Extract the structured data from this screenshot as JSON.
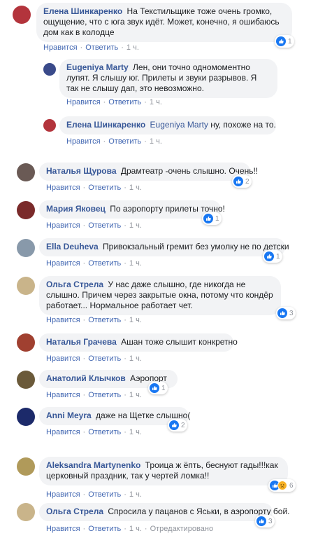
{
  "comments": [
    {
      "author": "Елена Шинкаренко",
      "text": "На Текстильщике тоже очень громко, ощущение, что с юга звук идёт. Может, конечно, я ошибаюсь дом как в колодце",
      "like": "Нравится",
      "reply": "Ответить",
      "time": "1 ч.",
      "reactions": "1",
      "avatar_color": "#b3343c"
    },
    {
      "author": "Eugeniya Marty",
      "text": "Лен, они точно одномоментно лупят. Я слышу юг. Прилеты и звуки разрывов. Я так не слышу дап, это невозможно.",
      "like": "Нравится",
      "reply": "Ответить",
      "time": "1 ч.",
      "avatar_color": "#3a4a8a"
    },
    {
      "author": "Елена Шинкаренко",
      "reply_to": "Eugeniya Marty",
      "text": "ну, похоже на то...",
      "like": "Нравится",
      "reply": "Ответить",
      "time": "1 ч.",
      "avatar_color": "#b3343c"
    },
    {
      "author": "Наталья Щурова",
      "text": "Драмтеатр -очень слышно. Очень!!",
      "like": "Нравится",
      "reply": "Ответить",
      "time": "1 ч.",
      "reactions": "2",
      "avatar_color": "#6a5a55"
    },
    {
      "author": "Мария Яковец",
      "text": "По аэропорту прилеты точно!",
      "like": "Нравится",
      "reply": "Ответить",
      "time": "1 ч.",
      "reactions": "1",
      "avatar_color": "#7a2a2a"
    },
    {
      "author": "Ella Deuheva",
      "text": "Привокзальный гремит без умолку не по детски",
      "like": "Нравится",
      "reply": "Ответить",
      "time": "1 ч.",
      "reactions": "1",
      "avatar_color": "#8899aa"
    },
    {
      "author": "Ольга Стрела",
      "text": "У нас даже слышно, где никогда не слышно. Причем через закрытые окна, потому что кондёр работает... Нормальное работает чет.",
      "like": "Нравится",
      "reply": "Ответить",
      "time": "1 ч.",
      "reactions": "3",
      "avatar_color": "#c9b48a"
    },
    {
      "author": "Наталья Грачева",
      "text": "Ашан тоже слышит конкретно",
      "like": "Нравится",
      "reply": "Ответить",
      "time": "1 ч.",
      "avatar_color": "#a04030"
    },
    {
      "author": "Анатолий Клычков",
      "text": "Аэропорт",
      "like": "Нравится",
      "reply": "Ответить",
      "time": "1 ч.",
      "reactions": "1",
      "avatar_color": "#6b5a3a"
    },
    {
      "author": "Anni Meyra",
      "text": "даже на Щетке слышно(",
      "like": "Нравится",
      "reply": "Ответить",
      "time": "1 ч.",
      "reactions": "2",
      "avatar_color": "#1c2a6a"
    },
    {
      "author": "Aleksandra Martynenko",
      "text": "Троица ж ёпть, беснуют гады!!!как церковный праздник, так у чертей ломка!!",
      "like": "Нравится",
      "reply": "Ответить",
      "time": "1 ч.",
      "reactions": "6",
      "avatar_color": "#b09a5a"
    },
    {
      "author": "Ольга Стрела",
      "text": "Спросила у пацанов с Яськи, в аэропорту бой.",
      "like": "Нравится",
      "reply": "Ответить",
      "time": "1 ч.",
      "edited": "Отредактировано",
      "reactions": "3",
      "avatar_color": "#c9b48a"
    }
  ],
  "colors": {
    "link": "#385898",
    "action": "#4267b2",
    "meta": "#90949c",
    "bubble": "#f2f3f5",
    "like": "#1877f2"
  },
  "sep": "·"
}
